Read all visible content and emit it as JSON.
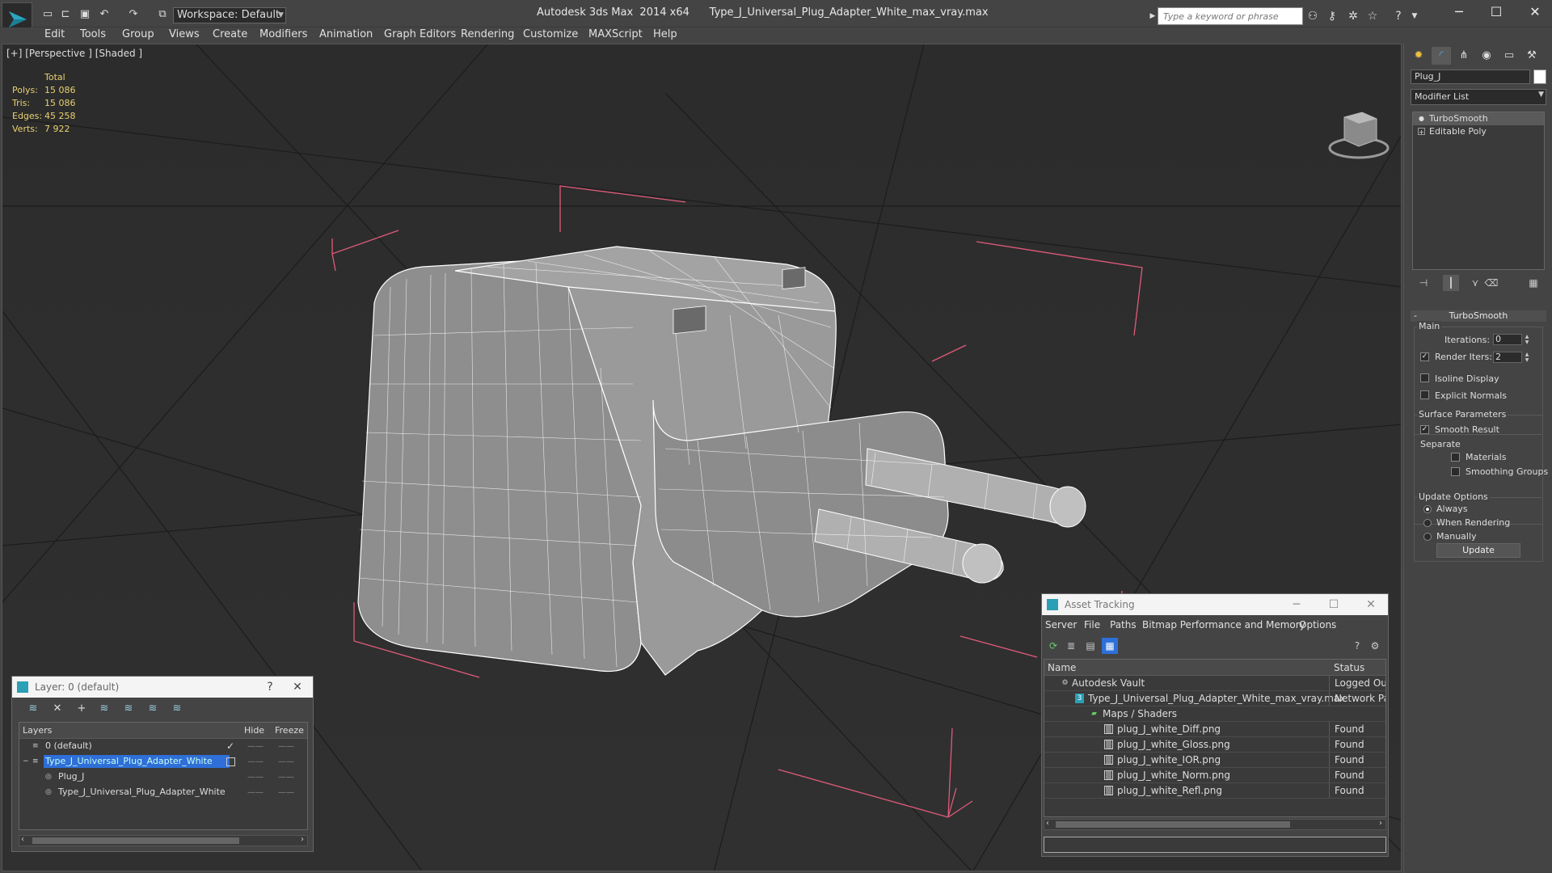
{
  "title_bar": {
    "app_title": "Autodesk 3ds Max  2014 x64      Type_J_Universal_Plug_Adapter_White_max_vray.max",
    "workspace_label": "Workspace: Default",
    "search_placeholder": "Type a keyword or phrase",
    "quick_access_icons": [
      "new-file-icon",
      "open-file-icon",
      "save-icon",
      "undo-icon",
      "redo-icon",
      "project-folder-icon"
    ],
    "toolbar_icons": [
      "binoculars-icon",
      "key-icon",
      "star-burst-icon",
      "favorite-star-icon",
      "help-icon"
    ],
    "window_controls": [
      "minimize",
      "maximize",
      "close"
    ]
  },
  "menu": {
    "items": [
      "Edit",
      "Tools",
      "Group",
      "Views",
      "Create",
      "Modifiers",
      "Animation",
      "Graph Editors",
      "Rendering",
      "Customize",
      "MAXScript",
      "Help"
    ]
  },
  "viewport": {
    "label": "[+] [Perspective ] [Shaded ]",
    "stats": {
      "header": "Total",
      "rows": [
        {
          "key": "Polys:",
          "value": "15 086"
        },
        {
          "key": "Tris:",
          "value": "15 086"
        },
        {
          "key": "Edges:",
          "value": "45 258"
        },
        {
          "key": "Verts:",
          "value": "7 922"
        }
      ]
    },
    "colors": {
      "background": "#2e2e2e",
      "grid": "#1f1f1f",
      "wire": "#ffffff",
      "mesh": "#9a9a9a",
      "bbox": "#e05a7a",
      "stats_text": "#e8d070"
    }
  },
  "command_panel": {
    "tabs": [
      "create-icon",
      "modify-icon",
      "hierarchy-icon",
      "motion-icon",
      "display-icon",
      "utilities-icon"
    ],
    "object_name": "Plug_J",
    "modifier_list_label": "Modifier List",
    "stack": [
      {
        "label": "TurboSmooth",
        "selected": true,
        "icon": "bulb-icon"
      },
      {
        "label": "Editable Poly",
        "selected": false,
        "icon": "expand-icon"
      }
    ],
    "rollout_title": "TurboSmooth",
    "main_group": "Main",
    "iterations_label": "Iterations:",
    "iterations_value": "0",
    "render_iters_label": "Render Iters:",
    "render_iters_value": "2",
    "render_iters_checked": true,
    "isoline_label": "Isoline Display",
    "explicit_normals_label": "Explicit Normals",
    "surface_group": "Surface Parameters",
    "smooth_result_label": "Smooth Result",
    "separate_label": "Separate",
    "materials_label": "Materials",
    "smoothing_groups_label": "Smoothing Groups",
    "update_group": "Update Options",
    "update_options": [
      {
        "label": "Always",
        "selected": true
      },
      {
        "label": "When Rendering",
        "selected": false
      },
      {
        "label": "Manually",
        "selected": false
      }
    ],
    "update_button": "Update"
  },
  "layer_dialog": {
    "title": "Layer: 0 (default)",
    "help": "?",
    "close": "✕",
    "columns": {
      "layers": "Layers",
      "hide": "Hide",
      "freeze": "Freeze"
    },
    "rows": [
      {
        "name": "0 (default)",
        "indent": 1,
        "selected": false,
        "current": true
      },
      {
        "name": "Type_J_Universal_Plug_Adapter_White",
        "indent": 1,
        "selected": true,
        "current": false
      },
      {
        "name": "Plug_J",
        "indent": 2,
        "selected": false,
        "current": false
      },
      {
        "name": "Type_J_Universal_Plug_Adapter_White",
        "indent": 2,
        "selected": false,
        "current": false
      }
    ]
  },
  "asset_dialog": {
    "title": "Asset Tracking",
    "menu": [
      "Server",
      "File",
      "Paths",
      "Bitmap Performance and Memory",
      "Options"
    ],
    "columns": {
      "name": "Name",
      "status": "Status"
    },
    "rows": [
      {
        "name": "Autodesk Vault",
        "status": "Logged Out",
        "indent": 1,
        "icon": "vault-icon"
      },
      {
        "name": "Type_J_Universal_Plug_Adapter_White_max_vray.max",
        "status": "Network Pat",
        "indent": 2,
        "icon": "max-file-icon"
      },
      {
        "name": "Maps / Shaders",
        "status": "",
        "indent": 3,
        "icon": "maps-icon"
      },
      {
        "name": "plug_J_white_Diff.png",
        "status": "Found",
        "indent": 4,
        "icon": "image-file-icon"
      },
      {
        "name": "plug_J_white_Gloss.png",
        "status": "Found",
        "indent": 4,
        "icon": "image-file-icon"
      },
      {
        "name": "plug_J_white_IOR.png",
        "status": "Found",
        "indent": 4,
        "icon": "image-file-icon"
      },
      {
        "name": "plug_J_white_Norm.png",
        "status": "Found",
        "indent": 4,
        "icon": "image-file-icon"
      },
      {
        "name": "plug_J_white_Refl.png",
        "status": "Found",
        "indent": 4,
        "icon": "image-file-icon"
      }
    ]
  }
}
